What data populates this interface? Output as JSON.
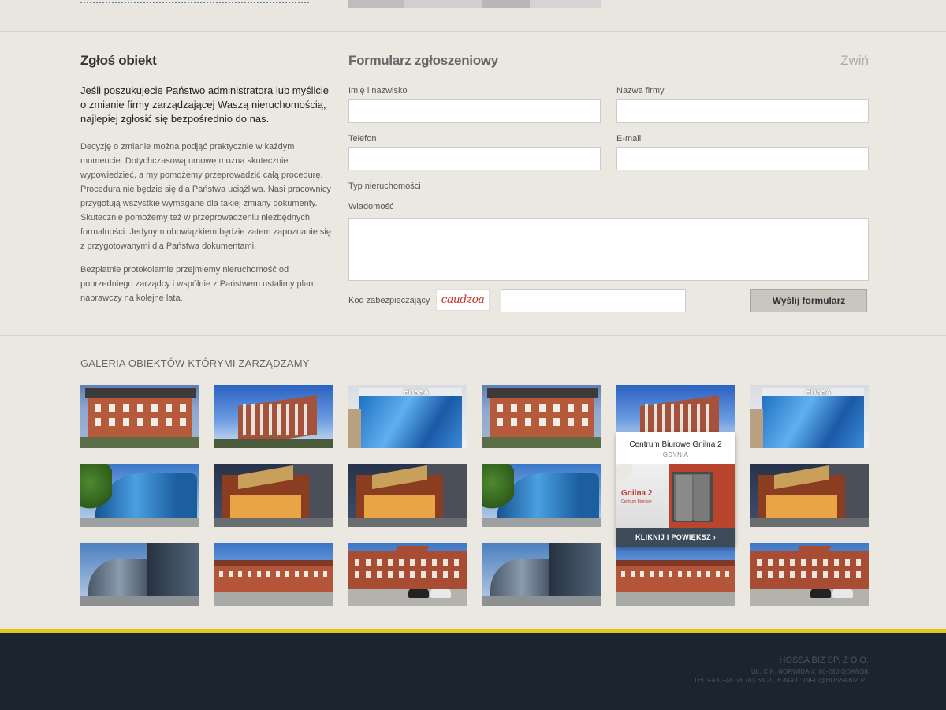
{
  "form_section": {
    "heading": "Zgłoś obiekt",
    "lead": "Jeśli poszukujecie Państwo administratora lub myślicie o zmianie firmy zarządzającej Waszą nieruchomością, najlepiej zgłosić się bezpośrednio do nas.",
    "paragraph1": "Decyzję o zmianie można podjąć praktycznie w każdym momencie. Dotychczasową umowę można skutecznie wypowiedzieć, a my pomożemy przeprowadzić całą procedurę. Procedura nie będzie się dla Państwa uciążliwa. Nasi pracownicy przygotują wszystkie wymagane dla takiej zmiany dokumenty. Skutecznie pomożemy też w przeprowadzeniu niezbędnych formalności. Jedynym obowiązkiem będzie zatem  zapoznanie się z przygotowanymi dla Państwa dokumentami.",
    "paragraph2": "Bezpłatnie protokolarnie przejmiemy nieruchomość od poprzedniego zarządcy i wspólnie z Państwem ustalimy plan naprawczy na kolejne lata."
  },
  "form": {
    "title": "Formularz zgłoszeniowy",
    "collapse": "Zwiń",
    "name_label": "Imię i nazwisko",
    "name_value": "",
    "company_label": "Nazwa firmy",
    "company_value": "",
    "phone_label": "Telefon",
    "phone_value": "",
    "email_label": "E-mail",
    "email_value": "",
    "property_type_label": "Typ nieruchomości",
    "message_label": "Wiadomość",
    "message_value": "",
    "captcha_label": "Kod zabezpieczający",
    "captcha_text": "caudzoa",
    "captcha_value": "",
    "submit": "Wyślij formularz"
  },
  "gallery": {
    "title": "GALERIA OBIEKTÓW KTÓRYMI ZARZĄDZAMY",
    "thumbnails": [
      {
        "kind": "brick-villa"
      },
      {
        "kind": "modern-office"
      },
      {
        "kind": "glass-hossa",
        "sign": "HOSSA"
      },
      {
        "kind": "brick-villa"
      },
      {
        "kind": "modern-office"
      },
      {
        "kind": "glass-hossa",
        "sign": "HOSSA"
      },
      {
        "kind": "round-glass"
      },
      {
        "kind": "night-mall"
      },
      {
        "kind": "night-mall"
      },
      {
        "kind": "round-glass"
      },
      {
        "kind": "hidden"
      },
      {
        "kind": "night-mall"
      },
      {
        "kind": "glass-corner"
      },
      {
        "kind": "long-brick"
      },
      {
        "kind": "brick-parking"
      },
      {
        "kind": "glass-corner"
      },
      {
        "kind": "long-brick"
      },
      {
        "kind": "brick-parking"
      }
    ],
    "hover_card": {
      "title": "Centrum Biurowe Gnilna 2",
      "city": "GDYNIA",
      "sign_line1": "Gnilna 2",
      "sign_line2": "Centrum Biurowe",
      "button": "KLIKNIJ I POWIĘKSZ ›"
    }
  },
  "footer": {
    "company": "HOSSA BIZ SP. Z O.O.",
    "address": "UL. C.K. NORWIDA 4, 80-280 GDAŃSK",
    "contact": "TEL.FAX +48 58 783 68 20, E-MAIL: INFO@HOSSABIZ.PL"
  },
  "colors": {
    "page_bg": "#ebe8e1",
    "footer_bg": "#1b2530",
    "footer_stripe": "#e1c619",
    "button_bg": "#c9c6bf",
    "hover_button_bg": "#3d4a57"
  }
}
